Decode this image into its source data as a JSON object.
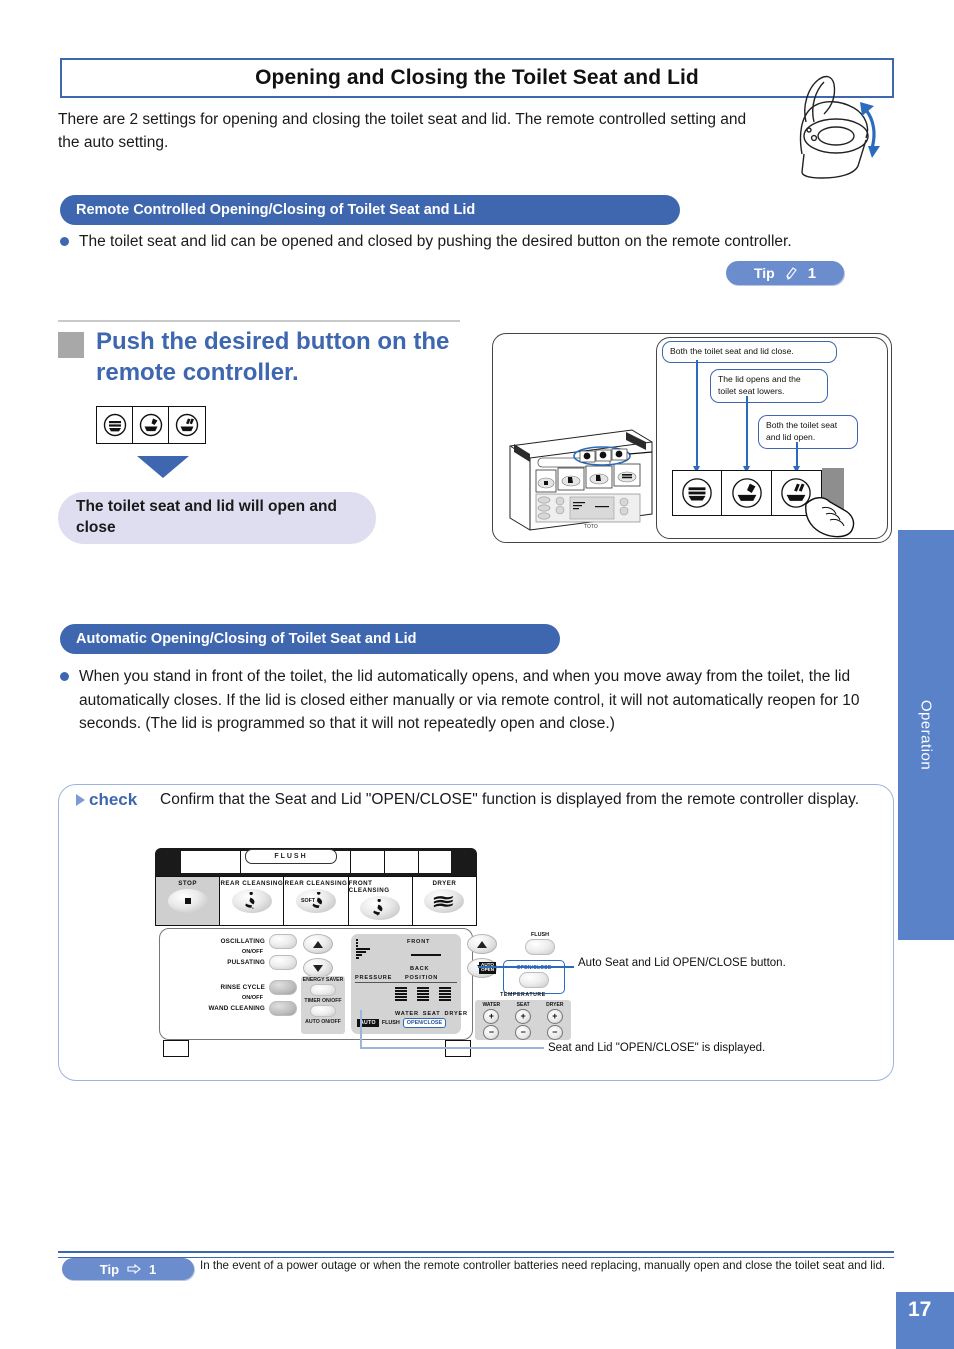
{
  "header": {
    "title": "Opening and Closing the Toilet Seat and Lid",
    "intro": "There are 2 settings for opening and closing the toilet seat and lid. The remote controlled setting and the auto setting."
  },
  "section_remote": {
    "pill_label": "Remote Controlled Opening/Closing of Toilet Seat and Lid",
    "bullet": "The toilet seat and lid can be opened and closed by pushing the desired button on the remote controller.",
    "tip_badge": {
      "label": "Tip",
      "number": "1",
      "icon": "pencil-icon"
    },
    "step_heading": "Push the desired button on the remote controller.",
    "result": "The toilet seat and lid will open and close",
    "button_icons": [
      "lid-closed-icon",
      "lid-open-seat-down-icon",
      "lid-and-seat-open-icon"
    ],
    "callouts": [
      "Both the toilet seat and lid close.",
      "The lid opens and the toilet seat lowers.",
      "Both the toilet seat and lid open."
    ]
  },
  "section_auto": {
    "pill_label": "Automatic Opening/Closing of Toilet Seat and Lid",
    "bullet": "When you stand in front of the toilet, the lid automatically opens, and when you move away from the toilet, the lid automatically closes. If the lid is closed either manually or via remote control, it will not automatically reopen for 10 seconds. (The lid is programmed so that it will not repeatedly open and close.)",
    "check": {
      "word": "check",
      "text": "Confirm that the Seat and Lid \"OPEN/CLOSE\" function is displayed from the remote controller display."
    },
    "notes": {
      "auto_button": "Auto Seat and Lid OPEN/CLOSE button.",
      "display": "Seat and Lid \"OPEN/CLOSE\" is displayed."
    }
  },
  "remote_controller": {
    "flush_label": "FLUSH",
    "top_buttons": [
      {
        "label": "STOP",
        "icon": "stop-square-icon"
      },
      {
        "label": "REAR CLEANSING",
        "icon": "rear-cleansing-icon"
      },
      {
        "label": "REAR CLEANSING",
        "icon": "rear-cleansing-soft-icon",
        "badge": "SOFT"
      },
      {
        "label": "FRONT CLEANSING",
        "icon": "front-cleansing-icon"
      },
      {
        "label": "DRYER",
        "icon": "dryer-waves-icon"
      }
    ],
    "left_controls": [
      {
        "label": "OSCILLATING",
        "sub": "ON/OFF"
      },
      {
        "label": "PULSATING",
        "sub": ""
      },
      {
        "label": "RINSE CYCLE",
        "sub": "ON/OFF"
      },
      {
        "label": "WAND CLEANING",
        "sub": ""
      }
    ],
    "energy_saver": {
      "title": "ENERGY SAVER",
      "timer": "TIMER ON/OFF",
      "auto": "AUTO ON/OFF"
    },
    "lcd": {
      "pressure": "PRESSURE",
      "position": "POSITION",
      "front": "FRONT",
      "back": "BACK",
      "meters": [
        "WATER",
        "SEAT",
        "DRYER"
      ],
      "auto": "AUTO",
      "flush": "FLUSH",
      "open_close": "OPEN/CLOSE"
    },
    "right_controls": {
      "flush": "FLUSH",
      "auto_tag": "AUTO OPEN",
      "open_close": "OPEN/CLOSE",
      "temperature_title": "TEMPERATURE",
      "temperature": [
        "WATER",
        "SEAT",
        "DRYER"
      ],
      "plus": "+",
      "minus": "−"
    },
    "brand": "TOTO"
  },
  "side_tab": {
    "label": "Operation"
  },
  "footer": {
    "tip_label": "Tip",
    "tip_number": "1",
    "text": "In the event of a power outage or when the remote controller batteries need replacing, manually open and close the toilet seat and lid.",
    "page": "17"
  },
  "colors": {
    "accent": "#3f67b0",
    "tab": "#5a82c8",
    "badge": "#6b8ccd",
    "result_bg": "#dedef0"
  }
}
